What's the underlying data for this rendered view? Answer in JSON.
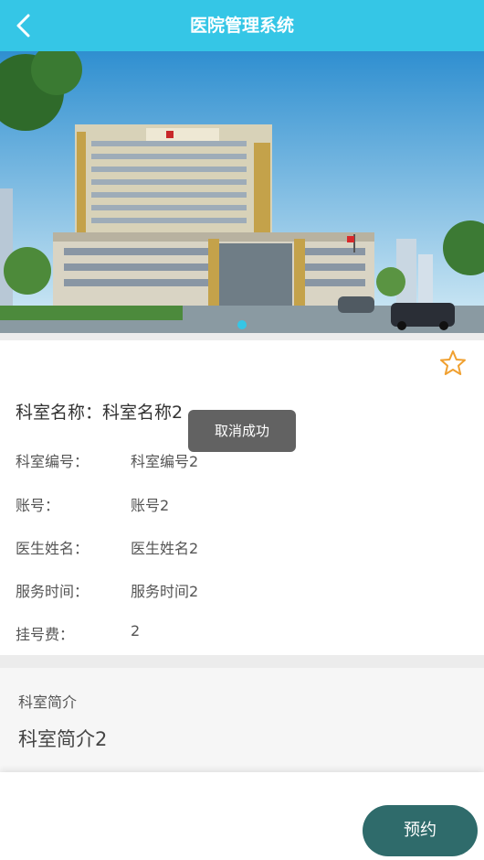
{
  "navbar": {
    "title": "医院管理系统",
    "back_icon": "chevron-left-icon"
  },
  "banner": {
    "image": "hospital-building-photo",
    "slide_count": 1,
    "active_slide": 1
  },
  "favorite_icon": "star-outline-icon",
  "department": {
    "name_label": "科室名称：",
    "name_value": "科室名称2",
    "fields": [
      {
        "label": "科室编号：",
        "value": "科室编号2"
      },
      {
        "label": "账号：",
        "value": "账号2"
      },
      {
        "label": "医生姓名：",
        "value": "医生姓名2"
      },
      {
        "label": "服务时间：",
        "value": "服务时间2"
      },
      {
        "label": "挂号费：",
        "value": "2"
      }
    ]
  },
  "intro": {
    "heading": "科室简介",
    "body": "科室简介2"
  },
  "toast": "取消成功",
  "footer": {
    "book_label": "预约"
  },
  "colors": {
    "primary": "#35c6e6",
    "button": "#2f6b6b",
    "star": "#f0a030"
  }
}
